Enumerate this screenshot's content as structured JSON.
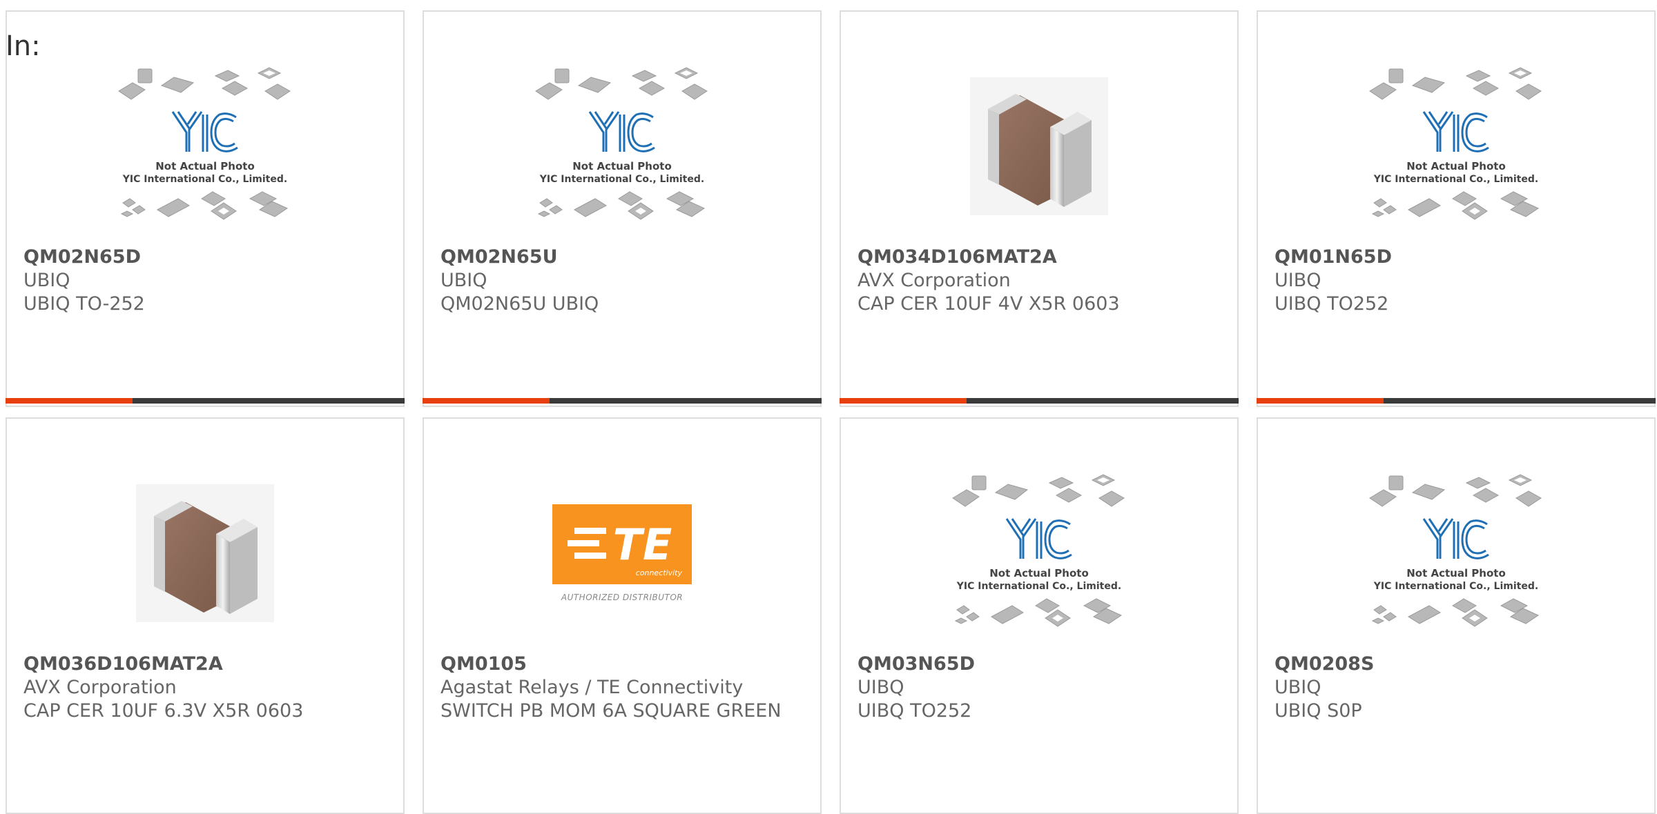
{
  "page": {
    "in_label": "In:"
  },
  "colors": {
    "accent": "#e8400c",
    "bar": "#3a3a3a",
    "border": "#dddddd",
    "logo_blue": "#1e6fb5",
    "te_orange": "#f7931e"
  },
  "placeholder": {
    "logo_text": "YIC",
    "line1": "Not Actual Photo",
    "line2": "YIC International Co., Limited."
  },
  "te_logo": {
    "brand": "TE",
    "sub": "connectivity",
    "authorized": "AUTHORIZED DISTRIBUTOR"
  },
  "products": [
    {
      "part": "QM02N65D",
      "manufacturer": "UBIQ",
      "description": "UBIQ TO-252",
      "image": "placeholder",
      "accent_bar": true
    },
    {
      "part": "QM02N65U",
      "manufacturer": "UBIQ",
      "description": "QM02N65U UBIQ",
      "image": "placeholder",
      "accent_bar": true
    },
    {
      "part": "QM034D106MAT2A",
      "manufacturer": "AVX Corporation",
      "description": "CAP CER 10UF 4V X5R 0603",
      "image": "capacitor",
      "accent_bar": true
    },
    {
      "part": "QM01N65D",
      "manufacturer": "UIBQ",
      "description": "UIBQ TO252",
      "image": "placeholder",
      "accent_bar": true
    },
    {
      "part": "QM036D106MAT2A",
      "manufacturer": "AVX Corporation",
      "description": "CAP CER 10UF 6.3V X5R 0603",
      "image": "capacitor",
      "accent_bar": false
    },
    {
      "part": "QM0105",
      "manufacturer": "Agastat Relays / TE Connectivity",
      "description": "SWITCH PB MOM 6A SQUARE GREEN",
      "image": "te-logo",
      "accent_bar": false
    },
    {
      "part": "QM03N65D",
      "manufacturer": "UIBQ",
      "description": "UIBQ TO252",
      "image": "placeholder",
      "accent_bar": false
    },
    {
      "part": "QM0208S",
      "manufacturer": "UBIQ",
      "description": "UBIQ S0P",
      "image": "placeholder",
      "accent_bar": false
    }
  ]
}
